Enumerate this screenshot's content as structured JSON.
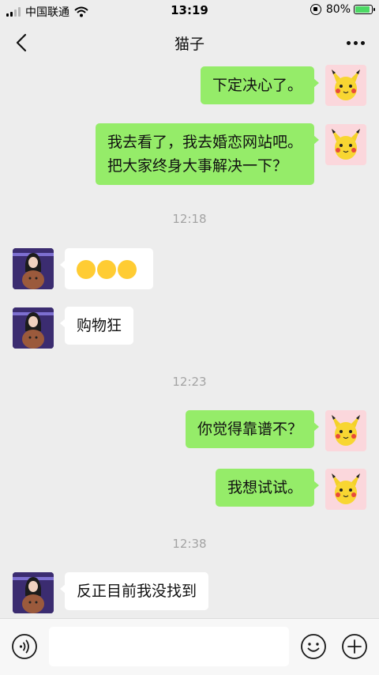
{
  "status_bar": {
    "carrier": "中国联通",
    "time": "13:19",
    "battery": "80%",
    "battery_level": 0.8,
    "wifi_icon": "wifi-icon",
    "orientation_lock_icon": "orientation-lock-icon"
  },
  "header": {
    "title": "猫子",
    "back_icon": "chevron-left-icon",
    "more_icon": "more-dots-icon"
  },
  "messages": [
    {
      "sender": "me",
      "text": "下定决心了。"
    },
    {
      "sender": "me",
      "lines": [
        "我去看了，我去婚恋网站吧。",
        "把大家终身大事解决一下？"
      ]
    },
    {
      "timestamp": "12:18"
    },
    {
      "sender": "other",
      "emoji": [
        "tears-of-joy-emoji",
        "tears-of-joy-emoji",
        "tears-of-joy-emoji"
      ]
    },
    {
      "sender": "other",
      "text": "购物狂"
    },
    {
      "timestamp": "12:23"
    },
    {
      "sender": "me",
      "text": "你觉得靠谱不？"
    },
    {
      "sender": "me",
      "text": "我想试试。"
    },
    {
      "timestamp": "12:38"
    },
    {
      "sender": "other",
      "text": "反正目前我没找到"
    }
  ],
  "input_bar": {
    "value": "",
    "voice_icon": "voice-icon",
    "emoji_icon": "emoji-icon",
    "plus_icon": "plus-icon"
  },
  "colors": {
    "background": "#ededed",
    "my_bubble": "#95ec69",
    "other_bubble": "#ffffff",
    "timestamp_text": "#a3a3a3"
  }
}
